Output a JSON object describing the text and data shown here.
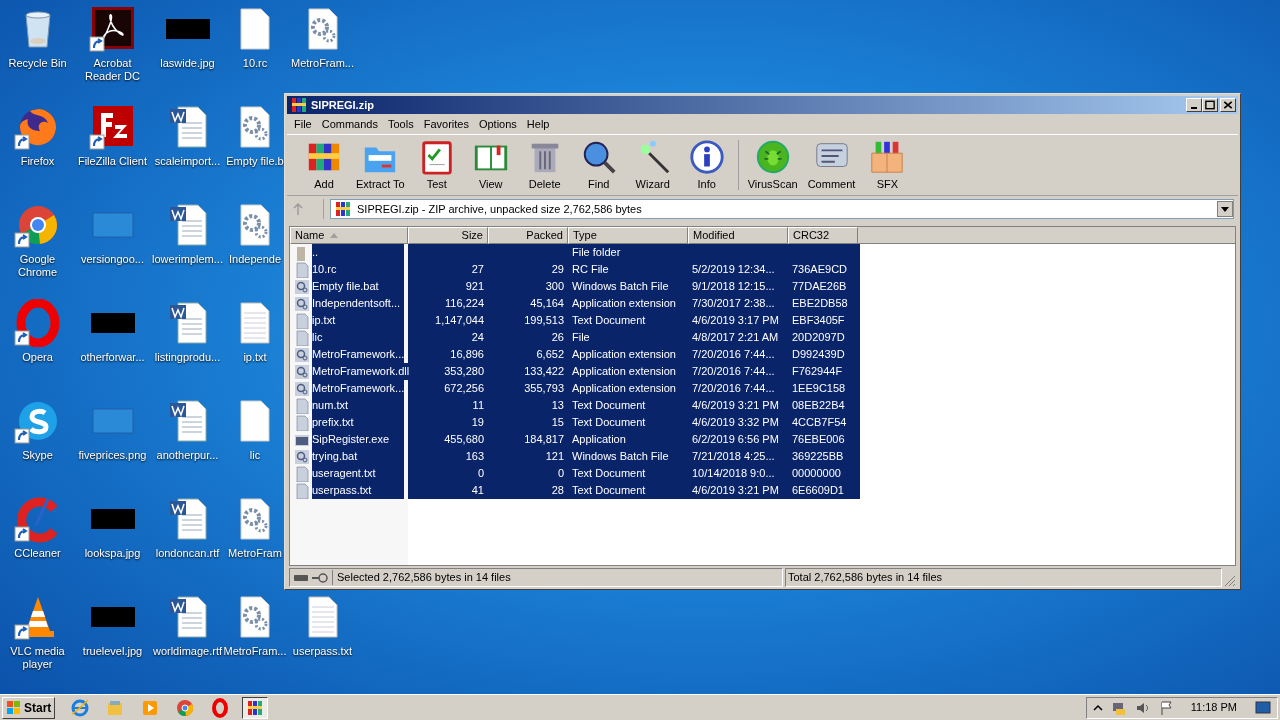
{
  "desktop": {
    "rows": [
      [
        {
          "label": "Recycle Bin",
          "kind": "recycle",
          "shortcut": false
        },
        {
          "label": "Acrobat Reader DC",
          "kind": "acrobat",
          "shortcut": true
        },
        {
          "label": "laswide.jpg",
          "kind": "black",
          "shortcut": false
        },
        {
          "label": "10.rc",
          "kind": "blank",
          "shortcut": false
        },
        {
          "label": "MetroFram...",
          "kind": "gear",
          "shortcut": false
        }
      ],
      [
        {
          "label": "Firefox",
          "kind": "firefox",
          "shortcut": true
        },
        {
          "label": "FileZilla Client",
          "kind": "filezilla",
          "shortcut": true
        },
        {
          "label": "scaleimport...",
          "kind": "word",
          "shortcut": false
        },
        {
          "label": "Empty file.b",
          "kind": "gear",
          "shortcut": false
        }
      ],
      [
        {
          "label": "Google Chrome",
          "kind": "chrome",
          "shortcut": true
        },
        {
          "label": "versiongoo...",
          "kind": "empty",
          "shortcut": false
        },
        {
          "label": "lowerimplem...",
          "kind": "word",
          "shortcut": false
        },
        {
          "label": "Independe",
          "kind": "gear",
          "shortcut": false
        }
      ],
      [
        {
          "label": "Opera",
          "kind": "opera",
          "shortcut": true
        },
        {
          "label": "otherforwar...",
          "kind": "black",
          "shortcut": false
        },
        {
          "label": "listingprodu...",
          "kind": "word",
          "shortcut": false
        },
        {
          "label": "ip.txt",
          "kind": "text",
          "shortcut": false
        }
      ],
      [
        {
          "label": "Skype",
          "kind": "skype",
          "shortcut": true
        },
        {
          "label": "fiveprices.png",
          "kind": "empty",
          "shortcut": false
        },
        {
          "label": "anotherpur...",
          "kind": "word",
          "shortcut": false
        },
        {
          "label": "lic",
          "kind": "blank",
          "shortcut": false
        }
      ],
      [
        {
          "label": "CCleaner",
          "kind": "ccleaner",
          "shortcut": true
        },
        {
          "label": "lookspa.jpg",
          "kind": "black",
          "shortcut": false
        },
        {
          "label": "londoncan.rtf",
          "kind": "word",
          "shortcut": false
        },
        {
          "label": "MetroFram",
          "kind": "gear",
          "shortcut": false
        }
      ],
      [
        {
          "label": "VLC media player",
          "kind": "vlc",
          "shortcut": true
        },
        {
          "label": "truelevel.jpg",
          "kind": "black",
          "shortcut": false
        },
        {
          "label": "worldimage.rtf",
          "kind": "word",
          "shortcut": false
        },
        {
          "label": "MetroFram...",
          "kind": "gear",
          "shortcut": false
        },
        {
          "label": "userpass.txt",
          "kind": "text",
          "shortcut": false
        }
      ]
    ]
  },
  "window": {
    "title": "SIPREGI.zip",
    "menu": [
      "File",
      "Commands",
      "Tools",
      "Favorites",
      "Options",
      "Help"
    ],
    "toolbar": [
      {
        "label": "Add",
        "kind": "add"
      },
      {
        "label": "Extract To",
        "kind": "extract"
      },
      {
        "label": "Test",
        "kind": "test"
      },
      {
        "label": "View",
        "kind": "view"
      },
      {
        "label": "Delete",
        "kind": "delete"
      },
      {
        "label": "Find",
        "kind": "find"
      },
      {
        "label": "Wizard",
        "kind": "wizard"
      },
      {
        "label": "Info",
        "kind": "info"
      },
      {
        "label": "VirusScan",
        "kind": "virus"
      },
      {
        "label": "Comment",
        "kind": "comment"
      },
      {
        "label": "SFX",
        "kind": "sfx"
      }
    ],
    "address": "SIPREGI.zip - ZIP archive, unpacked size 2,762,586 bytes",
    "columns": [
      {
        "label": "Name",
        "sorted": true
      },
      {
        "label": "Size",
        "sorted": false
      },
      {
        "label": "Packed",
        "sorted": false
      },
      {
        "label": "Type",
        "sorted": false
      },
      {
        "label": "Modified",
        "sorted": false
      },
      {
        "label": "CRC32",
        "sorted": false
      }
    ],
    "files": [
      {
        "kind": "folder",
        "name": "..",
        "type": "File folder",
        "selected": true
      },
      {
        "kind": "doc",
        "name": "10.rc",
        "size": "27",
        "packed": "29",
        "type": "RC File",
        "modified": "5/2/2019 12:34...",
        "crc": "736AE9CD",
        "selected": true
      },
      {
        "kind": "gear",
        "name": "Empty file.bat",
        "size": "921",
        "packed": "300",
        "type": "Windows Batch File",
        "modified": "9/1/2018 12:15...",
        "crc": "77DAE26B",
        "selected": true
      },
      {
        "kind": "gear",
        "name": "Independentsoft...",
        "size": "116,224",
        "packed": "45,164",
        "type": "Application extension",
        "modified": "7/30/2017 2:38...",
        "crc": "EBE2DB58",
        "selected": true
      },
      {
        "kind": "doc",
        "name": "ip.txt",
        "size": "1,147,044",
        "packed": "199,513",
        "type": "Text Document",
        "modified": "4/6/2019 3:17 PM",
        "crc": "EBF3405F",
        "selected": true
      },
      {
        "kind": "doc",
        "name": "lic",
        "size": "24",
        "packed": "26",
        "type": "File",
        "modified": "4/8/2017 2:21 AM",
        "crc": "20D2097D",
        "selected": true
      },
      {
        "kind": "gear",
        "name": "MetroFramework...",
        "size": "16,896",
        "packed": "6,652",
        "type": "Application extension",
        "modified": "7/20/2016 7:44...",
        "crc": "D992439D",
        "selected": true
      },
      {
        "kind": "gear",
        "name": "MetroFramework.dll",
        "size": "353,280",
        "packed": "133,422",
        "type": "Application extension",
        "modified": "7/20/2016 7:44...",
        "crc": "F762944F",
        "selected": true
      },
      {
        "kind": "gear",
        "name": "MetroFramework...",
        "size": "672,256",
        "packed": "355,793",
        "type": "Application extension",
        "modified": "7/20/2016 7:44...",
        "crc": "1EE9C158",
        "selected": true
      },
      {
        "kind": "doc",
        "name": "num.txt",
        "size": "11",
        "packed": "13",
        "type": "Text Document",
        "modified": "4/6/2019 3:21 PM",
        "crc": "08EB22B4",
        "selected": true
      },
      {
        "kind": "doc",
        "name": "prefix.txt",
        "size": "19",
        "packed": "15",
        "type": "Text Document",
        "modified": "4/6/2019 3:32 PM",
        "crc": "4CCB7F54",
        "selected": true
      },
      {
        "kind": "exe",
        "name": "SipRegister.exe",
        "size": "455,680",
        "packed": "184,817",
        "type": "Application",
        "modified": "6/2/2019 6:56 PM",
        "crc": "76EBE006",
        "selected": true
      },
      {
        "kind": "gear",
        "name": "trying.bat",
        "size": "163",
        "packed": "121",
        "type": "Windows Batch File",
        "modified": "7/21/2018 4:25...",
        "crc": "369225BB",
        "selected": true
      },
      {
        "kind": "doc",
        "name": "useragent.txt",
        "size": "0",
        "packed": "0",
        "type": "Text Document",
        "modified": "10/14/2018 9:0...",
        "crc": "00000000",
        "selected": true
      },
      {
        "kind": "doc",
        "name": "userpass.txt",
        "size": "41",
        "packed": "28",
        "type": "Text Document",
        "modified": "4/6/2019 3:21 PM",
        "crc": "6E6609D1",
        "selected": true
      }
    ],
    "status_selected": "Selected 2,762,586 bytes in 14 files",
    "status_total": "Total 2,762,586 bytes in 14 files"
  },
  "taskbar": {
    "start": "Start",
    "apps": [
      {
        "kind": "ie",
        "selected": false
      },
      {
        "kind": "explorer",
        "selected": false
      },
      {
        "kind": "media",
        "selected": false
      },
      {
        "kind": "chrome",
        "selected": false
      },
      {
        "kind": "opera",
        "selected": false
      },
      {
        "kind": "winrar",
        "selected": true
      }
    ],
    "clock": "11:18 PM"
  }
}
